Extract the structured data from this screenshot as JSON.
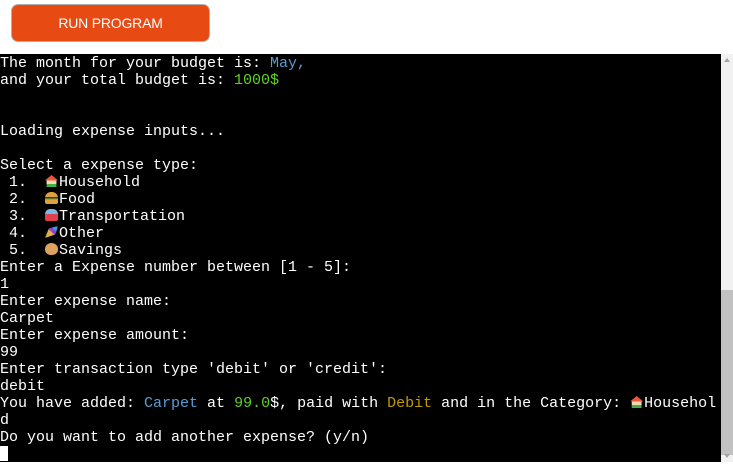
{
  "run_button": {
    "label": "RUN PROGRAM"
  },
  "colors": {
    "blue": "#5b9bd5",
    "green": "#5fd21f",
    "yellow": "#c09a00",
    "white": "#ffffff"
  },
  "terminal": {
    "lines": [
      [
        {
          "t": "The month for your budget is: "
        },
        {
          "t": "May,",
          "c": "blue"
        }
      ],
      [
        {
          "t": "and your total budget is: "
        },
        {
          "t": "1000$",
          "c": "green"
        }
      ],
      [],
      [],
      [
        {
          "t": "Loading expense inputs..."
        }
      ],
      [],
      [
        {
          "t": "Select a expense type:"
        }
      ],
      [
        {
          "t": " 1.  "
        },
        {
          "icon": "house-icon"
        },
        {
          "t": "Household"
        }
      ],
      [
        {
          "t": " 2.  "
        },
        {
          "icon": "burger-icon"
        },
        {
          "t": "Food"
        }
      ],
      [
        {
          "t": " 3.  "
        },
        {
          "icon": "car-icon"
        },
        {
          "t": "Transportation"
        }
      ],
      [
        {
          "t": " 4.  "
        },
        {
          "icon": "party-popper-icon"
        },
        {
          "t": "Other"
        }
      ],
      [
        {
          "t": " 5.  "
        },
        {
          "icon": "money-bag-icon"
        },
        {
          "t": "Savings"
        }
      ],
      [
        {
          "t": "Enter a Expense number between [1 - 5]:"
        }
      ],
      [
        {
          "t": "1"
        }
      ],
      [
        {
          "t": "Enter expense name:"
        }
      ],
      [
        {
          "t": "Carpet"
        }
      ],
      [
        {
          "t": "Enter expense amount:"
        }
      ],
      [
        {
          "t": "99"
        }
      ],
      [
        {
          "t": "Enter transaction type 'debit' or 'credit':"
        }
      ],
      [
        {
          "t": "debit"
        }
      ],
      [
        {
          "t": "You have added: "
        },
        {
          "t": "Carpet",
          "c": "blue"
        },
        {
          "t": " at "
        },
        {
          "t": "99.0",
          "c": "green"
        },
        {
          "t": "$, paid with "
        },
        {
          "t": "Debit",
          "c": "yellow"
        },
        {
          "t": " and in the Category: "
        },
        {
          "icon": "house-icon"
        },
        {
          "t": "Househol"
        }
      ],
      [
        {
          "t": "d"
        }
      ],
      [
        {
          "t": "Do you want to add another expense? (y/n)"
        }
      ],
      [
        {
          "cursor": true
        }
      ]
    ]
  }
}
